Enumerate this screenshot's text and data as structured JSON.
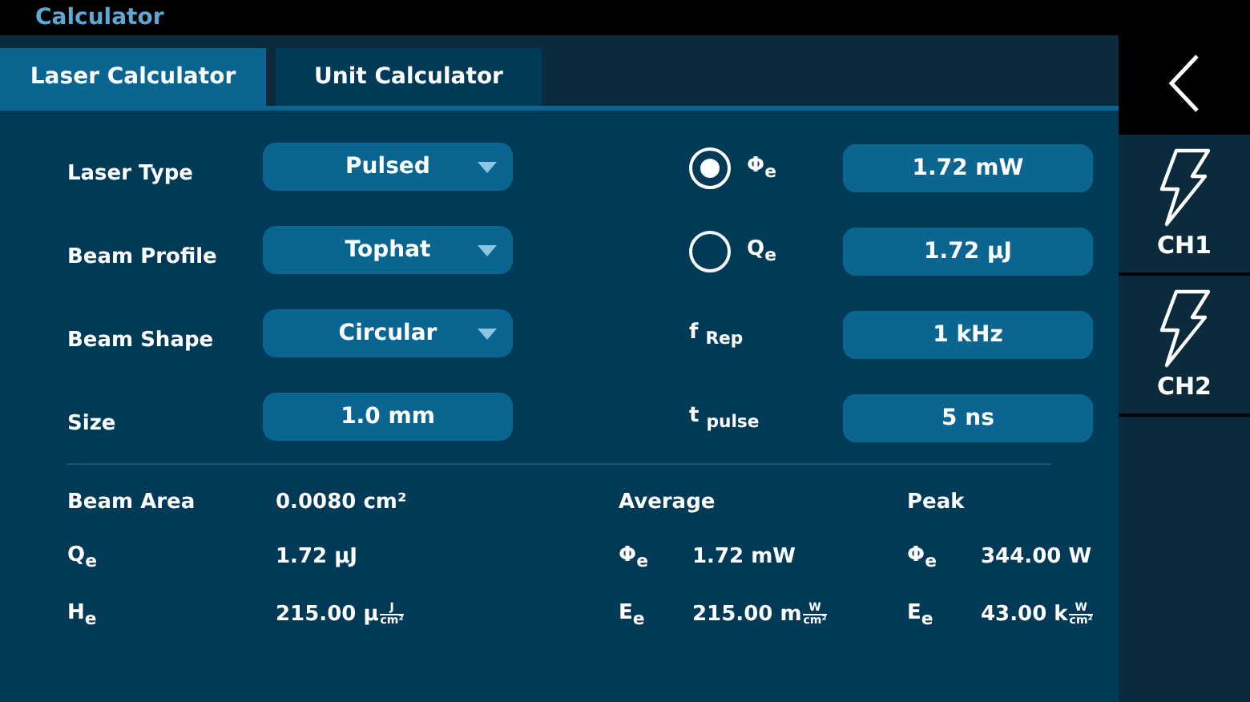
{
  "window": {
    "title": "Calculator"
  },
  "tabs": [
    {
      "label": "Laser Calculator",
      "selected": true
    },
    {
      "label": "Unit Calculator",
      "selected": false
    }
  ],
  "settings": [
    {
      "label": "Laser Type",
      "value": "Pulsed",
      "kind": "dropdown"
    },
    {
      "label": "Beam Profile",
      "value": "Tophat",
      "kind": "dropdown"
    },
    {
      "label": "Beam Shape",
      "value": "Circular",
      "kind": "dropdown"
    },
    {
      "label": "Size",
      "value": "1.0 mm",
      "kind": "input"
    }
  ],
  "modes": [
    {
      "symbol": "Φ$_{e}$",
      "selected": true,
      "value": "1.72 mW"
    },
    {
      "symbol": "Q$_{e}$",
      "selected": false,
      "value": "1.72 μJ"
    }
  ],
  "params": [
    {
      "symbol": "f $_{Rep}$",
      "value": "1 kHz"
    },
    {
      "symbol": "t $_{pulse}$",
      "value": "5 ns"
    }
  ],
  "results": {
    "beam_area": {
      "label": "Beam Area",
      "value": "0.0080 cm²"
    },
    "average_heading": "Average",
    "peak_heading": "Peak",
    "rows": [
      {
        "symbol": "Q$_{e}$",
        "value": {
          "text": "1.72 μJ"
        },
        "average": {
          "symbol": "Φ$_{e}$",
          "text": "1.72 mW"
        },
        "peak": {
          "symbol": "Φ$_{e}$",
          "text": "344.00 W"
        }
      },
      {
        "symbol": "H$_{e}$",
        "value": {
          "text": "215.00 μ",
          "num": "J",
          "den": "cm²"
        },
        "average": {
          "symbol": "E$_{e}$",
          "text": "215.00 m",
          "num": "W",
          "den": "cm²"
        },
        "peak": {
          "symbol": "E$_{e}$",
          "text": "43.00 k",
          "num": "W",
          "den": "cm²"
        }
      }
    ]
  },
  "channels": [
    {
      "label": "CH1"
    },
    {
      "label": "CH2"
    }
  ]
}
